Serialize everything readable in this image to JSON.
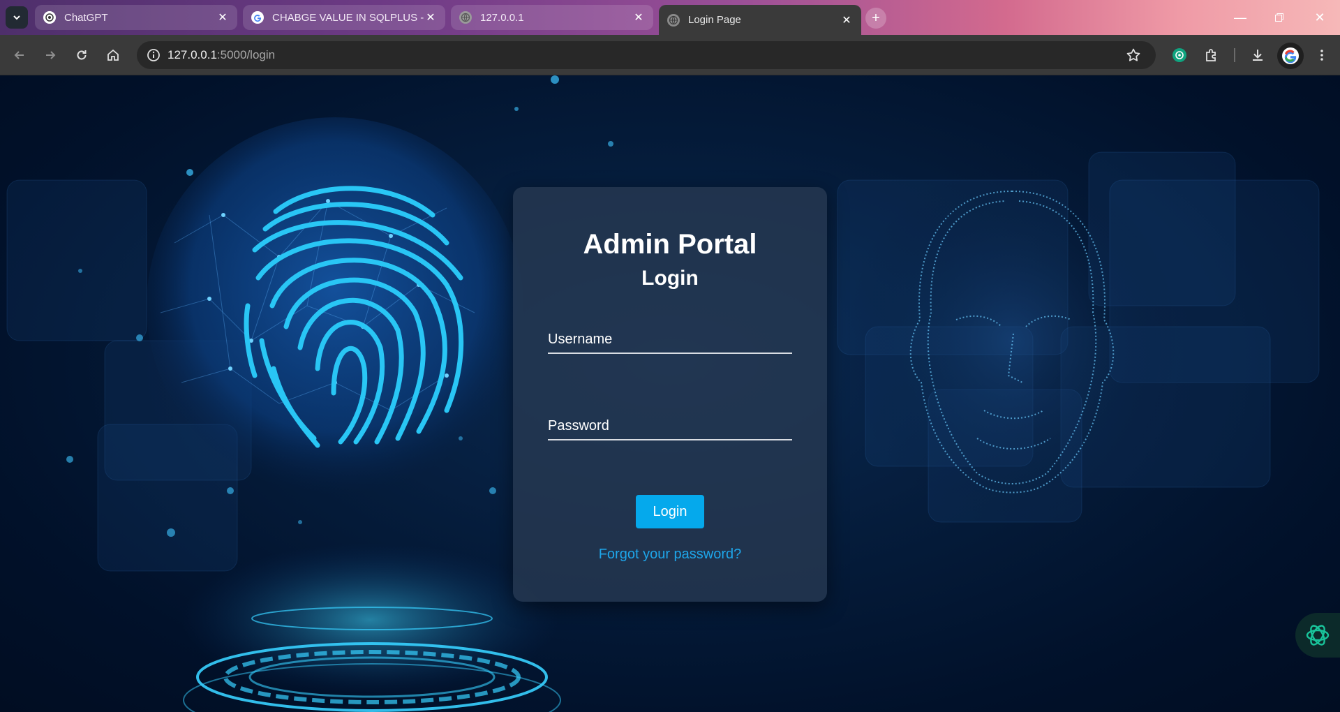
{
  "browser": {
    "tabs": [
      {
        "title": "ChatGPT",
        "favicon": "chatgpt-icon",
        "active": false
      },
      {
        "title": "CHABGE VALUE IN SQLPLUS - G",
        "favicon": "google-icon",
        "active": false
      },
      {
        "title": "127.0.0.1",
        "favicon": "globe-icon",
        "active": false
      },
      {
        "title": "Login Page",
        "favicon": "globe-icon",
        "active": true
      }
    ],
    "address": {
      "host": "127.0.0.1",
      "path": ":5000/login"
    }
  },
  "login": {
    "heading": "Admin Portal",
    "subheading": "Login",
    "username_placeholder": "Username",
    "password_placeholder": "Password",
    "submit_label": "Login",
    "forgot_label": "Forgot your password?"
  },
  "colors": {
    "accent": "#05a9ec",
    "link": "#1ea6ea",
    "background": "#01112a"
  }
}
